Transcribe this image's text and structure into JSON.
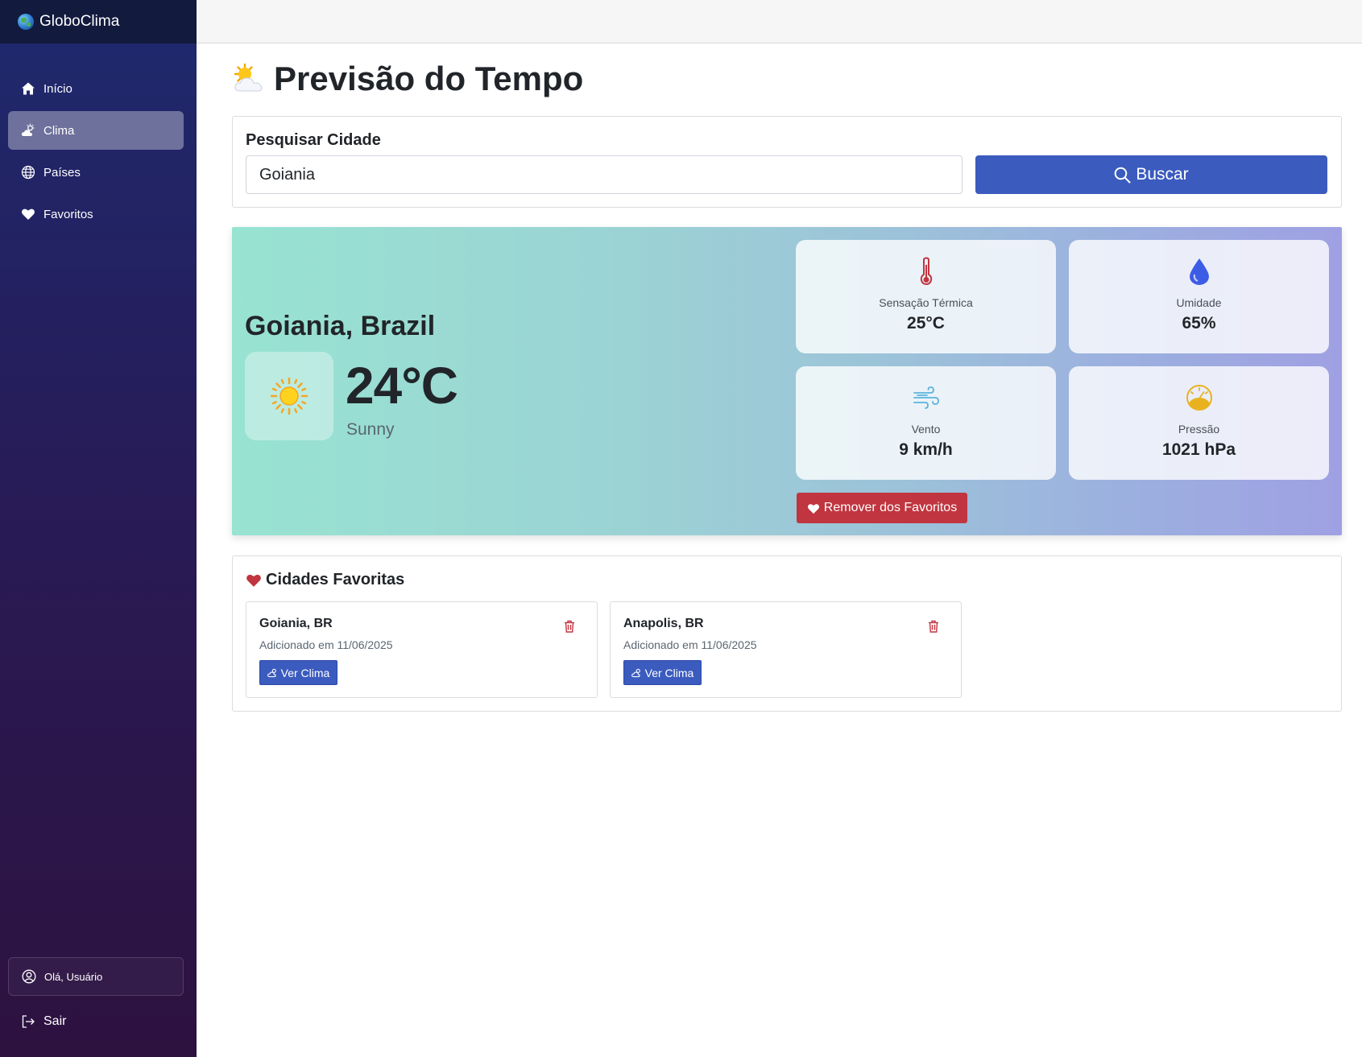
{
  "app": {
    "title": "GloboClima"
  },
  "sidebar": {
    "items": [
      {
        "label": "Início",
        "icon": "home-icon",
        "active": false
      },
      {
        "label": "Clima",
        "icon": "cloud-sun-icon",
        "active": true
      },
      {
        "label": "Países",
        "icon": "globe-icon",
        "active": false
      },
      {
        "label": "Favoritos",
        "icon": "heart-icon",
        "active": false
      }
    ],
    "user_greeting": "Olá, Usuário",
    "logout_label": "Sair"
  },
  "page": {
    "title": "Previsão do Tempo"
  },
  "search": {
    "label": "Pesquisar Cidade",
    "value": "Goiania",
    "button_label": "Buscar"
  },
  "weather": {
    "city": "Goiania, Brazil",
    "temperature": "24°C",
    "condition": "Sunny",
    "stats": {
      "feels_like": {
        "label": "Sensação Térmica",
        "value": "25°C"
      },
      "humidity": {
        "label": "Umidade",
        "value": "65%"
      },
      "wind": {
        "label": "Vento",
        "value": "9 km/h"
      },
      "pressure": {
        "label": "Pressão",
        "value": "1021 hPa"
      }
    },
    "remove_favorite_label": "Remover dos Favoritos"
  },
  "favorites": {
    "title": "Cidades Favoritas",
    "items": [
      {
        "name": "Goiania, BR",
        "date": "Adicionado em 11/06/2025",
        "button_label": "Ver Clima"
      },
      {
        "name": "Anapolis, BR",
        "date": "Adicionado em 11/06/2025",
        "button_label": "Ver Clima"
      }
    ]
  },
  "colors": {
    "primary": "#3b5bbf",
    "danger": "#c0353f",
    "sidebar_top": "#121a3e",
    "thermometer": "#c0353f",
    "humidity": "#3d5ce6",
    "wind": "#5bb4dc",
    "pressure": "#e8b21f"
  }
}
